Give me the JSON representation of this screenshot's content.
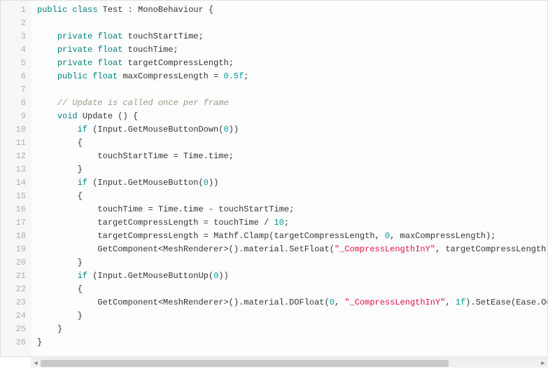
{
  "editor": {
    "language": "csharp",
    "line_count": 26,
    "colors": {
      "keyword": "#008080",
      "number": "#009999",
      "string": "#dd1144",
      "comment": "#999988",
      "text": "#333333",
      "gutter_bg": "#f7f7f7",
      "gutter_fg": "#afafaf",
      "code_bg": "#fdfdfd"
    },
    "lines": [
      {
        "n": 1,
        "tokens": [
          [
            "kw",
            "public"
          ],
          [
            "sp",
            " "
          ],
          [
            "kw",
            "class"
          ],
          [
            "sp",
            " "
          ],
          [
            "id",
            "Test"
          ],
          [
            "sp",
            " "
          ],
          [
            "punct",
            ":"
          ],
          [
            "sp",
            " "
          ],
          [
            "id",
            "MonoBehaviour"
          ],
          [
            "sp",
            " "
          ],
          [
            "punct",
            "{"
          ]
        ]
      },
      {
        "n": 2,
        "tokens": []
      },
      {
        "n": 3,
        "tokens": [
          [
            "sp",
            "    "
          ],
          [
            "kw",
            "private"
          ],
          [
            "sp",
            " "
          ],
          [
            "type",
            "float"
          ],
          [
            "sp",
            " "
          ],
          [
            "id",
            "touchStartTime"
          ],
          [
            "punct",
            ";"
          ]
        ]
      },
      {
        "n": 4,
        "tokens": [
          [
            "sp",
            "    "
          ],
          [
            "kw",
            "private"
          ],
          [
            "sp",
            " "
          ],
          [
            "type",
            "float"
          ],
          [
            "sp",
            " "
          ],
          [
            "id",
            "touchTime"
          ],
          [
            "punct",
            ";"
          ]
        ]
      },
      {
        "n": 5,
        "tokens": [
          [
            "sp",
            "    "
          ],
          [
            "kw",
            "private"
          ],
          [
            "sp",
            " "
          ],
          [
            "type",
            "float"
          ],
          [
            "sp",
            " "
          ],
          [
            "id",
            "targetCompressLength"
          ],
          [
            "punct",
            ";"
          ]
        ]
      },
      {
        "n": 6,
        "tokens": [
          [
            "sp",
            "    "
          ],
          [
            "kw",
            "public"
          ],
          [
            "sp",
            " "
          ],
          [
            "type",
            "float"
          ],
          [
            "sp",
            " "
          ],
          [
            "id",
            "maxCompressLength"
          ],
          [
            "sp",
            " "
          ],
          [
            "punct",
            "="
          ],
          [
            "sp",
            " "
          ],
          [
            "num",
            "0.5f"
          ],
          [
            "punct",
            ";"
          ]
        ]
      },
      {
        "n": 7,
        "tokens": []
      },
      {
        "n": 8,
        "tokens": [
          [
            "sp",
            "    "
          ],
          [
            "cmt",
            "// Update is called once per frame"
          ]
        ]
      },
      {
        "n": 9,
        "tokens": [
          [
            "sp",
            "    "
          ],
          [
            "kw",
            "void"
          ],
          [
            "sp",
            " "
          ],
          [
            "id",
            "Update"
          ],
          [
            "sp",
            " "
          ],
          [
            "punct",
            "()"
          ],
          [
            "sp",
            " "
          ],
          [
            "punct",
            "{"
          ]
        ]
      },
      {
        "n": 10,
        "tokens": [
          [
            "sp",
            "        "
          ],
          [
            "kw",
            "if"
          ],
          [
            "sp",
            " "
          ],
          [
            "punct",
            "("
          ],
          [
            "id",
            "Input"
          ],
          [
            "punct",
            "."
          ],
          [
            "id",
            "GetMouseButtonDown"
          ],
          [
            "punct",
            "("
          ],
          [
            "num",
            "0"
          ],
          [
            "punct",
            "))"
          ]
        ]
      },
      {
        "n": 11,
        "tokens": [
          [
            "sp",
            "        "
          ],
          [
            "punct",
            "{"
          ]
        ]
      },
      {
        "n": 12,
        "tokens": [
          [
            "sp",
            "            "
          ],
          [
            "id",
            "touchStartTime"
          ],
          [
            "sp",
            " "
          ],
          [
            "punct",
            "="
          ],
          [
            "sp",
            " "
          ],
          [
            "id",
            "Time"
          ],
          [
            "punct",
            "."
          ],
          [
            "id",
            "time"
          ],
          [
            "punct",
            ";"
          ]
        ]
      },
      {
        "n": 13,
        "tokens": [
          [
            "sp",
            "        "
          ],
          [
            "punct",
            "}"
          ]
        ]
      },
      {
        "n": 14,
        "tokens": [
          [
            "sp",
            "        "
          ],
          [
            "kw",
            "if"
          ],
          [
            "sp",
            " "
          ],
          [
            "punct",
            "("
          ],
          [
            "id",
            "Input"
          ],
          [
            "punct",
            "."
          ],
          [
            "id",
            "GetMouseButton"
          ],
          [
            "punct",
            "("
          ],
          [
            "num",
            "0"
          ],
          [
            "punct",
            "))"
          ]
        ]
      },
      {
        "n": 15,
        "tokens": [
          [
            "sp",
            "        "
          ],
          [
            "punct",
            "{"
          ]
        ]
      },
      {
        "n": 16,
        "tokens": [
          [
            "sp",
            "            "
          ],
          [
            "id",
            "touchTime"
          ],
          [
            "sp",
            " "
          ],
          [
            "punct",
            "="
          ],
          [
            "sp",
            " "
          ],
          [
            "id",
            "Time"
          ],
          [
            "punct",
            "."
          ],
          [
            "id",
            "time"
          ],
          [
            "sp",
            " "
          ],
          [
            "punct",
            "-"
          ],
          [
            "sp",
            " "
          ],
          [
            "id",
            "touchStartTime"
          ],
          [
            "punct",
            ";"
          ]
        ]
      },
      {
        "n": 17,
        "tokens": [
          [
            "sp",
            "            "
          ],
          [
            "id",
            "targetCompressLength"
          ],
          [
            "sp",
            " "
          ],
          [
            "punct",
            "="
          ],
          [
            "sp",
            " "
          ],
          [
            "id",
            "touchTime"
          ],
          [
            "sp",
            " "
          ],
          [
            "punct",
            "/"
          ],
          [
            "sp",
            " "
          ],
          [
            "num",
            "10"
          ],
          [
            "punct",
            ";"
          ]
        ]
      },
      {
        "n": 18,
        "tokens": [
          [
            "sp",
            "            "
          ],
          [
            "id",
            "targetCompressLength"
          ],
          [
            "sp",
            " "
          ],
          [
            "punct",
            "="
          ],
          [
            "sp",
            " "
          ],
          [
            "id",
            "Mathf"
          ],
          [
            "punct",
            "."
          ],
          [
            "id",
            "Clamp"
          ],
          [
            "punct",
            "("
          ],
          [
            "id",
            "targetCompressLength"
          ],
          [
            "punct",
            ","
          ],
          [
            "sp",
            " "
          ],
          [
            "num",
            "0"
          ],
          [
            "punct",
            ","
          ],
          [
            "sp",
            " "
          ],
          [
            "id",
            "maxCompressLength"
          ],
          [
            "punct",
            ");"
          ]
        ]
      },
      {
        "n": 19,
        "tokens": [
          [
            "sp",
            "            "
          ],
          [
            "id",
            "GetComponent"
          ],
          [
            "punct",
            "<"
          ],
          [
            "id",
            "MeshRenderer"
          ],
          [
            "punct",
            ">()."
          ],
          [
            "id",
            "material"
          ],
          [
            "punct",
            "."
          ],
          [
            "id",
            "SetFloat"
          ],
          [
            "punct",
            "("
          ],
          [
            "str",
            "\"_CompressLengthInY\""
          ],
          [
            "punct",
            ","
          ],
          [
            "sp",
            " "
          ],
          [
            "id",
            "targetCompressLength"
          ],
          [
            "punct",
            ");"
          ]
        ]
      },
      {
        "n": 20,
        "tokens": [
          [
            "sp",
            "        "
          ],
          [
            "punct",
            "}"
          ]
        ]
      },
      {
        "n": 21,
        "tokens": [
          [
            "sp",
            "        "
          ],
          [
            "kw",
            "if"
          ],
          [
            "sp",
            " "
          ],
          [
            "punct",
            "("
          ],
          [
            "id",
            "Input"
          ],
          [
            "punct",
            "."
          ],
          [
            "id",
            "GetMouseButtonUp"
          ],
          [
            "punct",
            "("
          ],
          [
            "num",
            "0"
          ],
          [
            "punct",
            "))"
          ]
        ]
      },
      {
        "n": 22,
        "tokens": [
          [
            "sp",
            "        "
          ],
          [
            "punct",
            "{"
          ]
        ]
      },
      {
        "n": 23,
        "tokens": [
          [
            "sp",
            "            "
          ],
          [
            "id",
            "GetComponent"
          ],
          [
            "punct",
            "<"
          ],
          [
            "id",
            "MeshRenderer"
          ],
          [
            "punct",
            ">()."
          ],
          [
            "id",
            "material"
          ],
          [
            "punct",
            "."
          ],
          [
            "id",
            "DOFloat"
          ],
          [
            "punct",
            "("
          ],
          [
            "num",
            "0"
          ],
          [
            "punct",
            ","
          ],
          [
            "sp",
            " "
          ],
          [
            "str",
            "\"_CompressLengthInY\""
          ],
          [
            "punct",
            ","
          ],
          [
            "sp",
            " "
          ],
          [
            "num",
            "1f"
          ],
          [
            "punct",
            ")."
          ],
          [
            "id",
            "SetEase"
          ],
          [
            "punct",
            "("
          ],
          [
            "id",
            "Ease"
          ],
          [
            "punct",
            "."
          ],
          [
            "id",
            "OutElastic"
          ],
          [
            "punct",
            ");"
          ]
        ]
      },
      {
        "n": 24,
        "tokens": [
          [
            "sp",
            "        "
          ],
          [
            "punct",
            "}"
          ]
        ]
      },
      {
        "n": 25,
        "tokens": [
          [
            "sp",
            "    "
          ],
          [
            "punct",
            "}"
          ]
        ]
      },
      {
        "n": 26,
        "tokens": [
          [
            "punct",
            "}"
          ]
        ]
      }
    ],
    "scrollbar": {
      "orientation": "horizontal",
      "thumb_position_pct": 0,
      "thumb_size_pct": 82,
      "left_arrow_glyph": "◀",
      "right_arrow_glyph": "▶"
    }
  }
}
